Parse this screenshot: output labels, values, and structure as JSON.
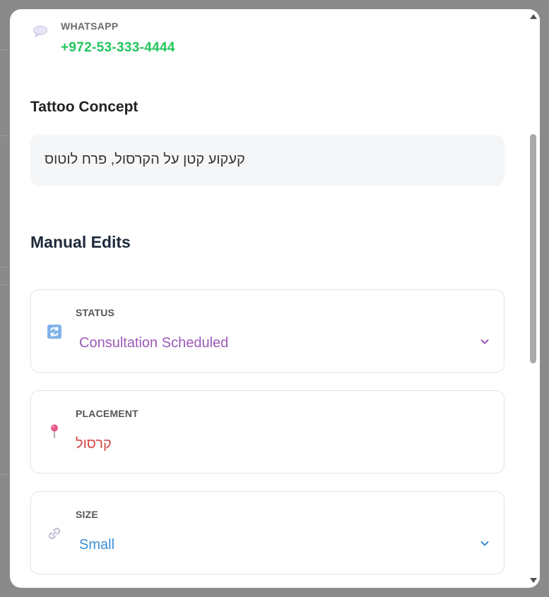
{
  "contact": {
    "label": "WHATSAPP",
    "value": "+972-53-333-4444",
    "icon": "speech-bubble-icon"
  },
  "concept": {
    "title": "Tattoo Concept",
    "text": "קעקוע קטן על הקרסול, פרח לוטוס"
  },
  "manual_edits": {
    "title": "Manual Edits",
    "fields": [
      {
        "label": "STATUS",
        "value": "Consultation Scheduled",
        "icon": "refresh-icon",
        "value_color": "#9b59b6",
        "has_dropdown": true
      },
      {
        "label": "PLACEMENT",
        "value": "קרסול",
        "icon": "pushpin-icon",
        "value_color": "#d64545",
        "has_dropdown": false
      },
      {
        "label": "SIZE",
        "value": "Small",
        "icon": "link-icon",
        "value_color": "#3b8fd6",
        "has_dropdown": true
      }
    ]
  },
  "colors": {
    "accent_green": "#22c55e",
    "overlay": "#8a8a8a"
  }
}
